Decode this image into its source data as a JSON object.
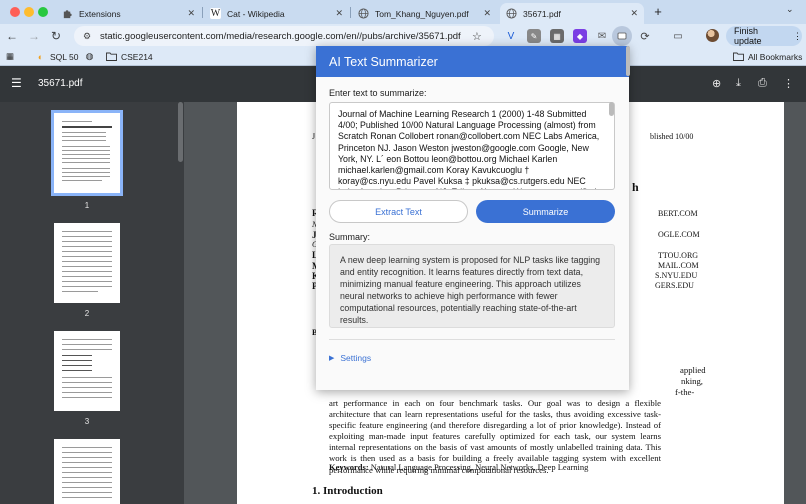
{
  "tabs": [
    {
      "label": "Extensions",
      "icon": "puzzle-icon"
    },
    {
      "label": "Cat - Wikipedia",
      "icon": "wikipedia-icon",
      "glyph": "W"
    },
    {
      "label": "Tom_Khang_Nguyen.pdf",
      "icon": "globe-icon"
    },
    {
      "label": "35671.pdf",
      "icon": "globe-icon"
    }
  ],
  "toolbar": {
    "url": "static.googleusercontent.com/media/research.google.com/en//pubs/archive/35671.pdf",
    "update_label": "Finish update"
  },
  "bookmarks": {
    "items": [
      {
        "label": "SQL 50"
      },
      {
        "label": ""
      },
      {
        "label": "CSE214"
      }
    ],
    "all_label": "All Bookmarks"
  },
  "pdf": {
    "filename": "35671.pdf",
    "thumbnails": [
      "1",
      "2",
      "3"
    ],
    "page_fragments": {
      "j": "J",
      "published": "blished 10/00",
      "h": "h",
      "r1": "BERT.COM",
      "r2": "OGLE.COM",
      "r3": "TTOU.ORG",
      "r4": "MAIL.COM",
      "r5": "S.NYU.EDU",
      "r6": "GERS.EDU",
      "applied": "applied",
      "nking": "nking,",
      "the": "f-the-",
      "b": "B"
    },
    "abstract_text": "art performance in each on four benchmark tasks.  Our goal was to design a flexible architecture that can learn representations useful for the tasks, thus avoiding excessive task-specific feature engineering (and therefore disregarding a lot of prior knowledge).  Instead of exploiting man-made input features carefully optimized for each task, our system learns internal representations on the basis of vast amounts of mostly unlabelled training data. This work is then used as a basis for building a freely available tagging system with excellent performance while requiring minimal computational resources.",
    "keywords_label": "Keywords:",
    "keywords": "Natural Language Processing, Neural Networks, Deep Learning",
    "section_title": "1.  Introduction"
  },
  "popup": {
    "title": "AI Text Summarizer",
    "input_label": "Enter text to summarize:",
    "input_text": "Journal of Machine Learning Research 1 (2000) 1-48 Submitted 4/00; Published 10/00 Natural Language Processing (almost) from Scratch Ronan Collobert ronan@collobert.com NEC Labs America, Princeton NJ. Jason Weston jweston@google.com Google, New York, NY. L´ eon Bottou leon@bottou.org Michael Karlen michael.karlen@gmail.com Koray Kavukcuoglu † koray@cs.nyu.edu Pavel Kuksa ‡ pkuksa@cs.rutgers.edu NEC Labs America, Princeton NJ. Editor: Abstract We propose a unified neural network architecture and learning algorithm that can be applied to various",
    "extract_label": "Extract Text",
    "summarize_label": "Summarize",
    "summary_label": "Summary:",
    "summary_text": "A new deep learning system is proposed for NLP tasks like tagging and entity recognition. It learns features directly from text data, minimizing manual feature engineering. This approach utilizes neural networks to achieve high performance with fewer computational resources, potentially reaching state-of-the-art results.",
    "settings_label": "Settings"
  },
  "colors": {
    "accent": "#3a71d4",
    "tabstrip": "#c9dbf0",
    "pdf_toolbar": "#323639"
  }
}
